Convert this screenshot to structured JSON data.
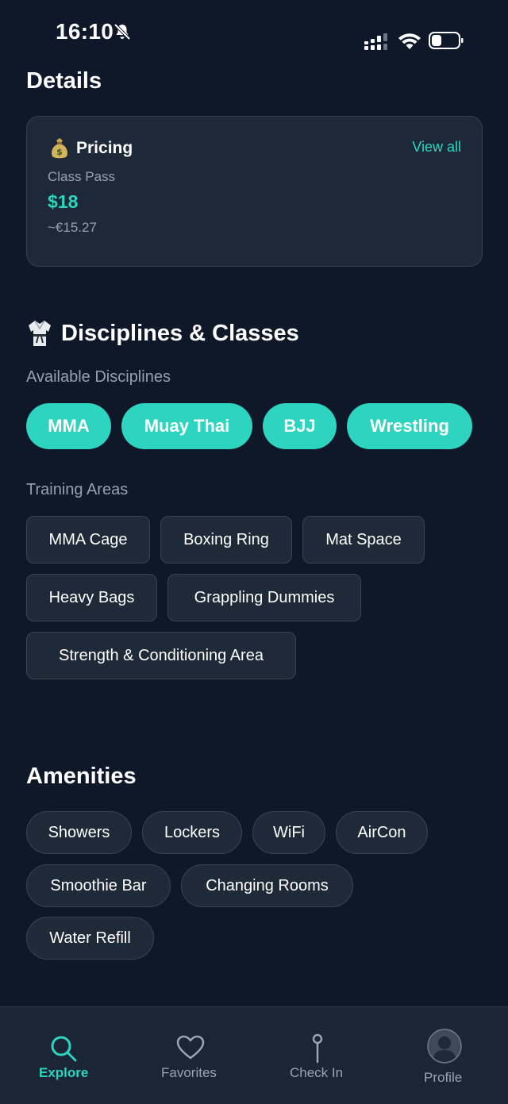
{
  "status": {
    "time": "16:10"
  },
  "details": {
    "heading": "Details",
    "pricing": {
      "title": "Pricing",
      "view_all": "View all",
      "pass_label": "Class Pass",
      "price": "$18",
      "converted": "~€15.27"
    }
  },
  "disciplines": {
    "heading": "Disciplines & Classes",
    "available_label": "Available Disciplines",
    "items": [
      "MMA",
      "Muay Thai",
      "BJJ",
      "Wrestling"
    ],
    "training_label": "Training Areas",
    "areas": [
      "MMA Cage",
      "Boxing Ring",
      "Mat Space",
      "Heavy Bags",
      "Grappling Dummies",
      "Strength & Conditioning Area"
    ]
  },
  "amenities": {
    "heading": "Amenities",
    "items": [
      "Showers",
      "Lockers",
      "WiFi",
      "AirCon",
      "Smoothie Bar",
      "Changing Rooms",
      "Water Refill"
    ]
  },
  "nav": {
    "items": [
      {
        "label": "Explore",
        "icon": "search-icon",
        "active": true
      },
      {
        "label": "Favorites",
        "icon": "heart-icon",
        "active": false
      },
      {
        "label": "Check In",
        "icon": "pin-icon",
        "active": false
      },
      {
        "label": "Profile",
        "icon": "avatar",
        "active": false
      }
    ]
  },
  "colors": {
    "accent": "#2dd4bf",
    "background": "#0f1829",
    "card": "#1d2938",
    "muted": "#96a1af"
  }
}
